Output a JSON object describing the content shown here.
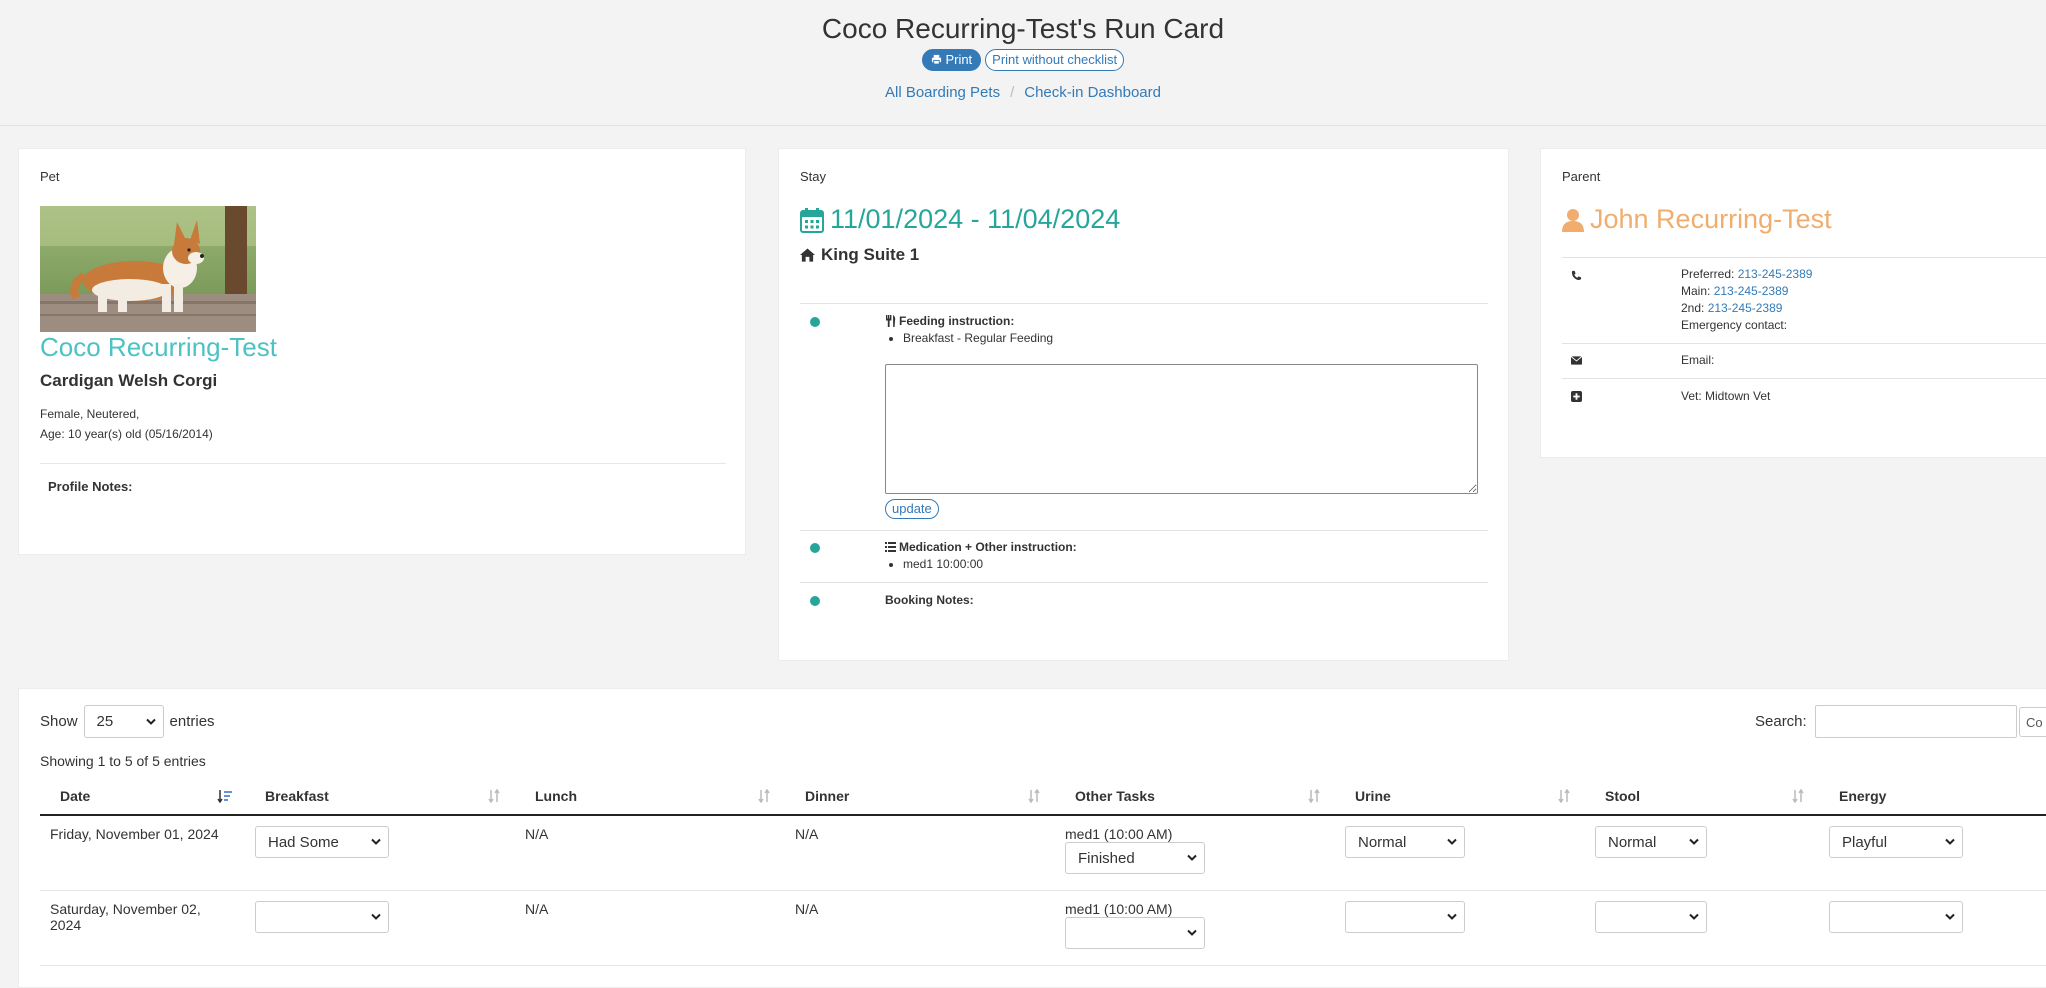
{
  "header": {
    "title": "Coco Recurring-Test's Run Card",
    "print_label": "Print",
    "print_no_checklist_label": "Print without checklist",
    "breadcrumbs": [
      "All Boarding Pets",
      "Check-in Dashboard"
    ]
  },
  "pet": {
    "section_label": "Pet",
    "name": "Coco Recurring-Test",
    "breed": "Cardigan Welsh Corgi",
    "sex_line": "Female, Neutered,",
    "age_line": "Age: 10 year(s) old (05/16/2014)",
    "profile_notes_label": "Profile Notes:"
  },
  "stay": {
    "section_label": "Stay",
    "dates": "11/01/2024 - 11/04/2024",
    "room": "King Suite 1",
    "feeding_title": "Feeding instruction:",
    "feeding_items": [
      "Breakfast - Regular Feeding"
    ],
    "feeding_text_value": "",
    "update_label": "update",
    "medication_title": "Medication + Other instruction:",
    "medication_items": [
      "med1 10:00:00"
    ],
    "booking_notes_label": "Booking Notes:"
  },
  "parent": {
    "section_label": "Parent",
    "name": "John Recurring-Test",
    "preferred_label": "Preferred:",
    "preferred_phone": "213-245-2389",
    "main_label": "Main:",
    "main_phone": "213-245-2389",
    "second_label": "2nd:",
    "second_phone": "213-245-2389",
    "emergency_label": "Emergency contact:",
    "email_label": "Email:",
    "vet_label": "Vet: Midtown Vet"
  },
  "table": {
    "show_label": "Show",
    "page_size": "25",
    "entries_label": "entries",
    "search_label": "Search:",
    "copy_label": "Co",
    "info": "Showing 1 to 5 of 5 entries",
    "columns": [
      "Date",
      "Breakfast",
      "Lunch",
      "Dinner",
      "Other Tasks",
      "Urine",
      "Stool",
      "Energy"
    ],
    "rows": [
      {
        "date": "Friday, November 01, 2024",
        "breakfast": "Had Some",
        "lunch": "N/A",
        "dinner": "N/A",
        "task": "med1 (10:00 AM)",
        "task_status": "Finished",
        "urine": "Normal",
        "stool": "Normal",
        "energy": "Playful"
      },
      {
        "date": "Saturday, November 02, 2024",
        "breakfast": "",
        "lunch": "N/A",
        "dinner": "N/A",
        "task": "med1 (10:00 AM)",
        "task_status": "",
        "urine": "",
        "stool": "",
        "energy": ""
      }
    ]
  },
  "colors": {
    "link": "#337ab7",
    "pet_name": "#4cc2c4",
    "stay_accent": "#26a69a",
    "parent_accent": "#f0ad6e"
  }
}
